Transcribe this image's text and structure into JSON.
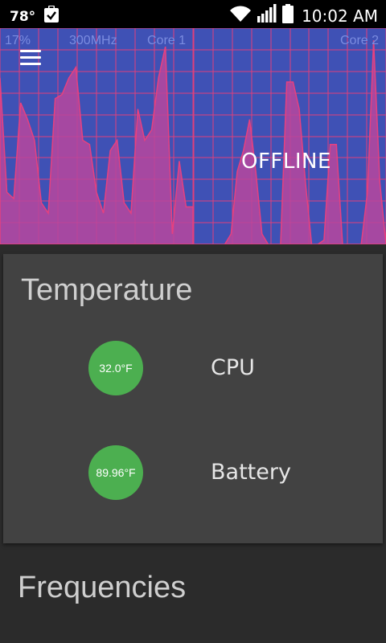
{
  "status_bar": {
    "temperature": "78°",
    "notification_icon": "clipboard-check-icon",
    "wifi_icon": "wifi-icon",
    "signal_icon": "cell-signal-icon",
    "battery_icon": "battery-icon",
    "time": "10:02 AM"
  },
  "graphs": {
    "core1": {
      "load": "17%",
      "frequency": "300MHz",
      "name": "Core 1",
      "values": [
        80,
        25,
        22,
        68,
        60,
        50,
        20,
        15,
        70,
        72,
        80,
        85,
        50,
        48,
        25,
        15,
        45,
        50,
        20,
        15,
        65,
        50,
        55,
        80,
        95,
        5,
        40,
        18,
        18
      ]
    },
    "core2": {
      "name": "Core 2",
      "status": "OFFLINE",
      "values": [
        0,
        0,
        0,
        0,
        0,
        0,
        5,
        35,
        45,
        60,
        35,
        5,
        0,
        0,
        0,
        78,
        78,
        65,
        30,
        0,
        0,
        2,
        48,
        48,
        0,
        0,
        0,
        0,
        25,
        98,
        30,
        0
      ]
    },
    "colors": {
      "background": "#3f51b5",
      "grid": "#e03f7a",
      "line": "#e6417f",
      "fill": "#b9479e"
    }
  },
  "menu_icon": "hamburger-menu-icon",
  "temperature_card": {
    "title": "Temperature",
    "sensors": [
      {
        "value": "32.0°F",
        "label": "CPU"
      },
      {
        "value": "89.96°F",
        "label": "Battery"
      }
    ],
    "circle_color": "#4caf50"
  },
  "frequencies_section": {
    "title": "Frequencies"
  }
}
